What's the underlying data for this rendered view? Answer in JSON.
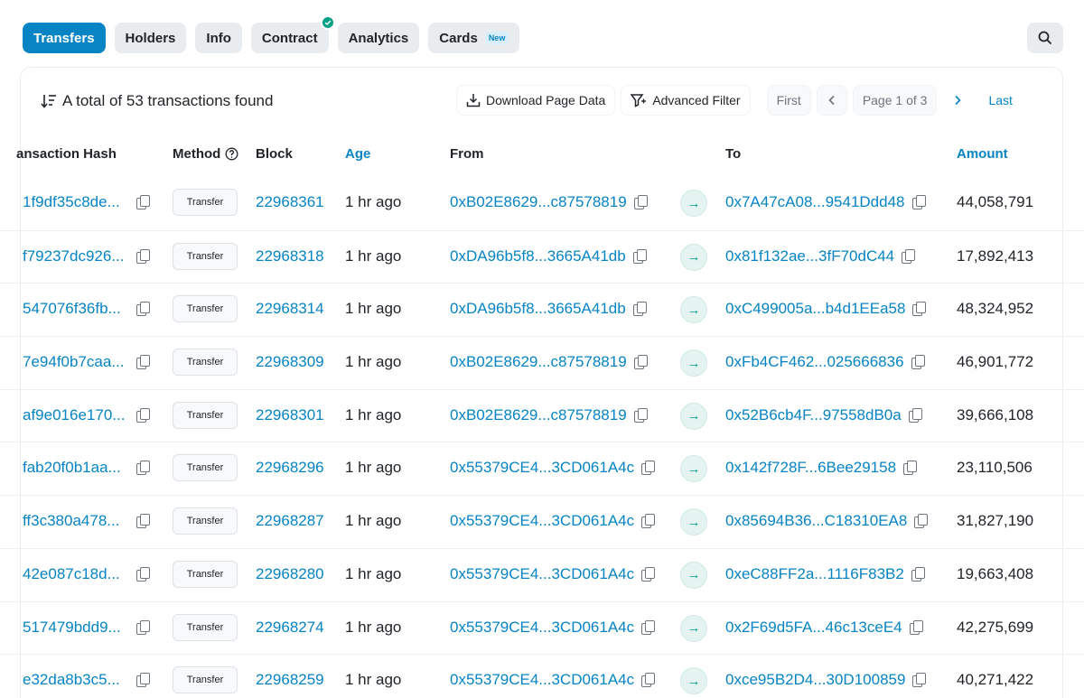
{
  "tabs": [
    {
      "label": "Transfers",
      "active": true
    },
    {
      "label": "Holders"
    },
    {
      "label": "Info"
    },
    {
      "label": "Contract",
      "verified": true
    },
    {
      "label": "Analytics"
    },
    {
      "label": "Cards",
      "badge": "New"
    }
  ],
  "summary": {
    "text": "A total of 53 transactions found"
  },
  "toolbar": {
    "download_label": "Download Page Data",
    "filter_label": "Advanced Filter",
    "first_label": "First",
    "prev_icon": "chevron-left-icon",
    "page_label": "Page 1 of 3",
    "next_icon": "chevron-right-icon",
    "last_label": "Last"
  },
  "columns": {
    "hash": "ansaction Hash",
    "method": "Method",
    "block": "Block",
    "age": "Age",
    "from": "From",
    "to": "To",
    "amount": "Amount"
  },
  "rows": [
    {
      "hash": "1f9df35c8de...",
      "method": "Transfer",
      "block": "22968361",
      "age": "1 hr ago",
      "from": "0xB02E8629...c87578819",
      "to": "0x7A47cA08...9541Ddd48",
      "amount": "44,058,791"
    },
    {
      "hash": "f79237dc926...",
      "method": "Transfer",
      "block": "22968318",
      "age": "1 hr ago",
      "from": "0xDA96b5f8...3665A41db",
      "to": "0x81f132ae...3fF70dC44",
      "amount": "17,892,413"
    },
    {
      "hash": "547076f36fb...",
      "method": "Transfer",
      "block": "22968314",
      "age": "1 hr ago",
      "from": "0xDA96b5f8...3665A41db",
      "to": "0xC499005a...b4d1EEa58",
      "amount": "48,324,952"
    },
    {
      "hash": "7e94f0b7caa...",
      "method": "Transfer",
      "block": "22968309",
      "age": "1 hr ago",
      "from": "0xB02E8629...c87578819",
      "to": "0xFb4CF462...025666836",
      "amount": "46,901,772"
    },
    {
      "hash": "af9e016e170...",
      "method": "Transfer",
      "block": "22968301",
      "age": "1 hr ago",
      "from": "0xB02E8629...c87578819",
      "to": "0x52B6cb4F...97558dB0a",
      "amount": "39,666,108"
    },
    {
      "hash": "fab20f0b1aa...",
      "method": "Transfer",
      "block": "22968296",
      "age": "1 hr ago",
      "from": "0x55379CE4...3CD061A4c",
      "to": "0x142f728F...6Bee29158",
      "amount": "23,110,506"
    },
    {
      "hash": "ff3c380a478...",
      "method": "Transfer",
      "block": "22968287",
      "age": "1 hr ago",
      "from": "0x55379CE4...3CD061A4c",
      "to": "0x85694B36...C18310EA8",
      "amount": "31,827,190"
    },
    {
      "hash": "42e087c18d...",
      "method": "Transfer",
      "block": "22968280",
      "age": "1 hr ago",
      "from": "0x55379CE4...3CD061A4c",
      "to": "0xeC88FF2a...1116F83B2",
      "amount": "19,663,408"
    },
    {
      "hash": "517479bdd9...",
      "method": "Transfer",
      "block": "22968274",
      "age": "1 hr ago",
      "from": "0x55379CE4...3CD061A4c",
      "to": "0x2F69d5FA...46c13ceE4",
      "amount": "42,275,699"
    },
    {
      "hash": "e32da8b3c5...",
      "method": "Transfer",
      "block": "22968259",
      "age": "1 hr ago",
      "from": "0x55379CE4...3CD061A4c",
      "to": "0xce95B2D4...30D100859",
      "amount": "40,271,422"
    }
  ],
  "colors": {
    "accent": "#0784c3",
    "success": "#00a186"
  }
}
